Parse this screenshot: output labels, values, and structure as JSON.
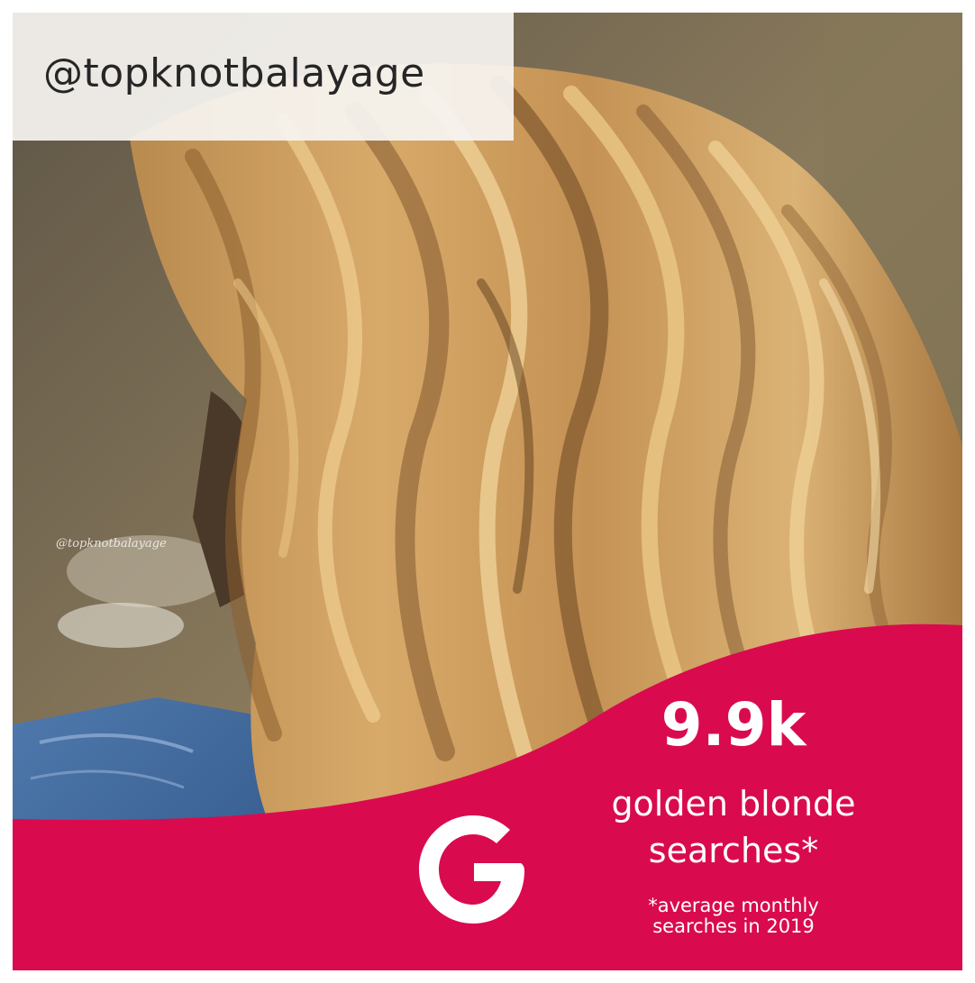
{
  "handle": "@topknotbalayage",
  "watermark": "@topknotbalayage",
  "stat": {
    "value": "9.9k",
    "label_line1": "golden blonde",
    "label_line2": "searches*",
    "note_line1": "*average monthly",
    "note_line2": "searches in 2019"
  },
  "logo_icon": "google-g-icon",
  "colors": {
    "accent": "#d90b4e",
    "text_light": "#ffffff",
    "handle_bg": "#f6f4f1",
    "handle_text": "#262626"
  }
}
